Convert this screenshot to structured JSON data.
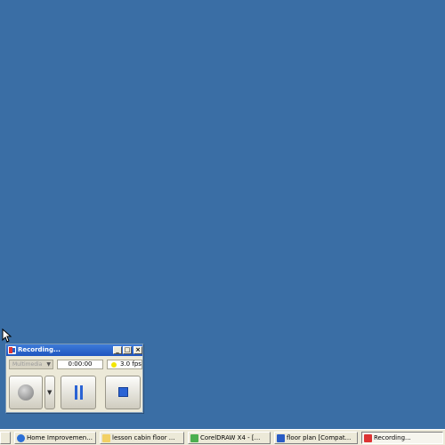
{
  "recorder": {
    "title": "Recording...",
    "mode_label": "Multimedia",
    "timer": "0:00:00",
    "fps": "3.0 fps",
    "colors": {
      "title_bar": "#1f55bf",
      "fps_indicator": "#f2e600",
      "control_icons": "#2a63d4"
    }
  },
  "taskbar": {
    "items": [
      {
        "label": "Home Improvemen...",
        "icon": "ie-icon"
      },
      {
        "label": "lesson cabin floor ...",
        "icon": "folder-icon"
      },
      {
        "label": "CorelDRAW X4 - [...",
        "icon": "coreldraw-icon"
      },
      {
        "label": "floor plan [Compat...",
        "icon": "document-icon"
      },
      {
        "label": "Recording...",
        "icon": "recorder-icon",
        "active": true
      }
    ]
  },
  "desktop": {
    "background": "#3a6ea5"
  }
}
